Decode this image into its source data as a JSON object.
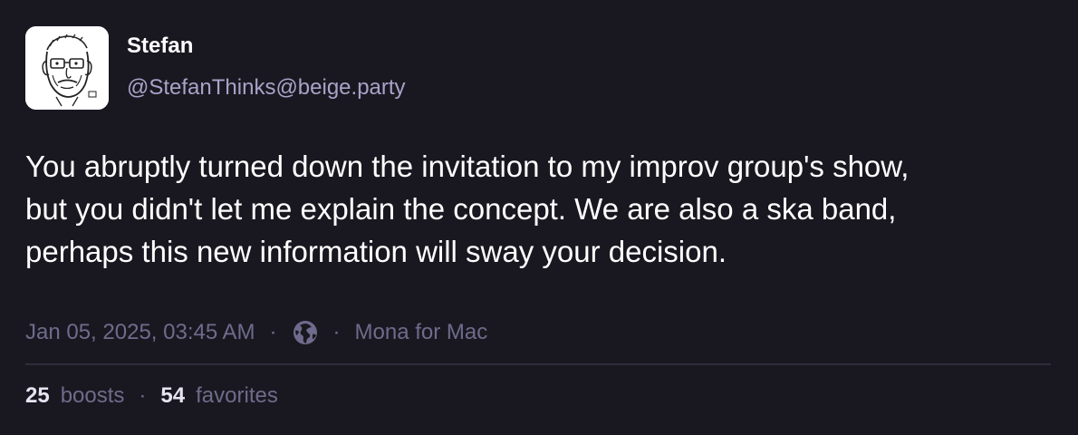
{
  "author": {
    "display_name": "Stefan",
    "handle": "@StefanThinks@beige.party",
    "avatar_icon": "cartoon-portrait-avatar"
  },
  "post": {
    "lines": [
      "You abruptly turned down the invitation to my improv group's show,",
      "but you didn't let me explain the concept. We are also a ska band,",
      "perhaps this new information will sway your decision."
    ],
    "timestamp": "Jan 05, 2025, 03:45 AM",
    "separator": "·",
    "visibility_icon": "globe-icon",
    "client": "Mona for Mac"
  },
  "stats": {
    "boosts_count": "25",
    "boosts_label": "boosts",
    "separator": "·",
    "favorites_count": "54",
    "favorites_label": "favorites"
  },
  "colors": {
    "background": "#191820",
    "text": "#ffffff",
    "handle": "#a8a3c9",
    "muted": "#6f6b8c",
    "divider": "#2f2d3b"
  }
}
